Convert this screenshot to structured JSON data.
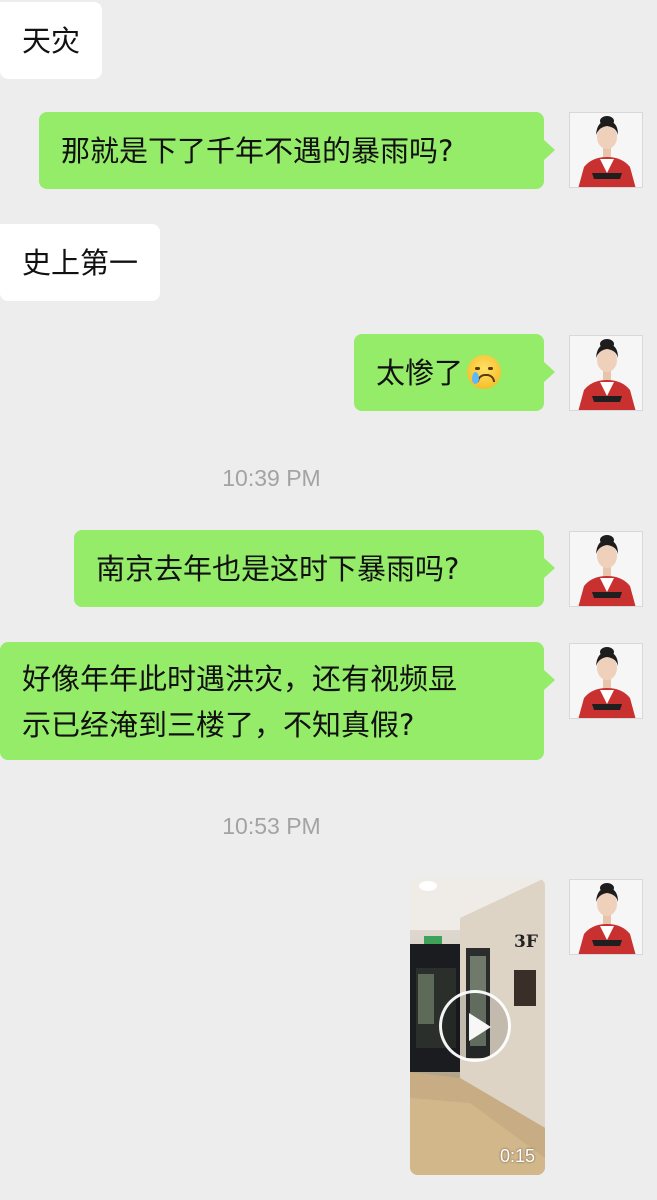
{
  "messages": [
    {
      "side": "in",
      "text": "天灾"
    },
    {
      "side": "out",
      "text": "那就是下了千年不遇的暴雨吗?"
    },
    {
      "side": "in",
      "text": "史上第一"
    },
    {
      "side": "out",
      "text": "太惨了",
      "emoji": "crying-face-icon"
    },
    {
      "side": "out",
      "text": "南京去年也是这时下暴雨吗?"
    },
    {
      "side": "out",
      "text_line1": "好像年年此时遇洪灾，还有视频显",
      "text_line2": "示已经淹到三楼了，不知真假?"
    },
    {
      "side": "out",
      "type": "video",
      "duration": "0:15",
      "sign_text": "3F"
    }
  ],
  "timestamps": [
    "10:39 PM",
    "10:53 PM"
  ],
  "colors": {
    "background": "#ededed",
    "outgoing_bubble": "#95ec69",
    "incoming_bubble": "#ffffff",
    "timestamp": "#a3a3a3"
  }
}
